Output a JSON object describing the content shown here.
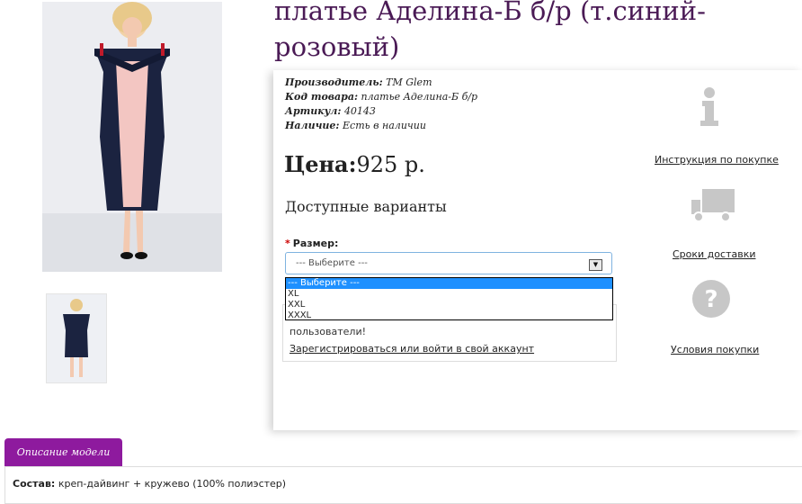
{
  "product": {
    "title": "платье Аделина-Б б/р (т.синий-розовый)"
  },
  "attributes": [
    {
      "label": "Производитель:",
      "value": "TM Glem"
    },
    {
      "label": "Код товара:",
      "value": "платье Аделина-Б б/р"
    },
    {
      "label": "Артикул:",
      "value": "40143"
    },
    {
      "label": "Наличие:",
      "value": "Есть в наличии"
    }
  ],
  "price": {
    "label": "Цена:",
    "value": "925 р."
  },
  "variants": {
    "heading": "Доступные варианты",
    "size_label": "Размер:",
    "required_mark": "*",
    "select_value": "--- Выберите ---",
    "options": [
      "--- Выберите ---",
      "XL",
      "XXL",
      "XXXL"
    ]
  },
  "notice": {
    "text": "пользователи!",
    "link": "Зарегистрироваться или войти в свой аккаунт"
  },
  "side": {
    "instruction_link": "Инструкция по покупке",
    "delivery_link": "Сроки доставки",
    "terms_link": "Условия покупки"
  },
  "tabs": {
    "description_tab": "Описание модели"
  },
  "description": {
    "label": "Состав:",
    "text": "креп-дайвинг + кружево (100% полиэстер)"
  },
  "colors": {
    "title": "#4a1a55",
    "tab_bg": "#8e1a9e",
    "dropdown_selected": "#1e90ff"
  },
  "icons": {
    "instruction": "info-icon",
    "delivery": "truck-icon",
    "terms": "question-icon"
  }
}
